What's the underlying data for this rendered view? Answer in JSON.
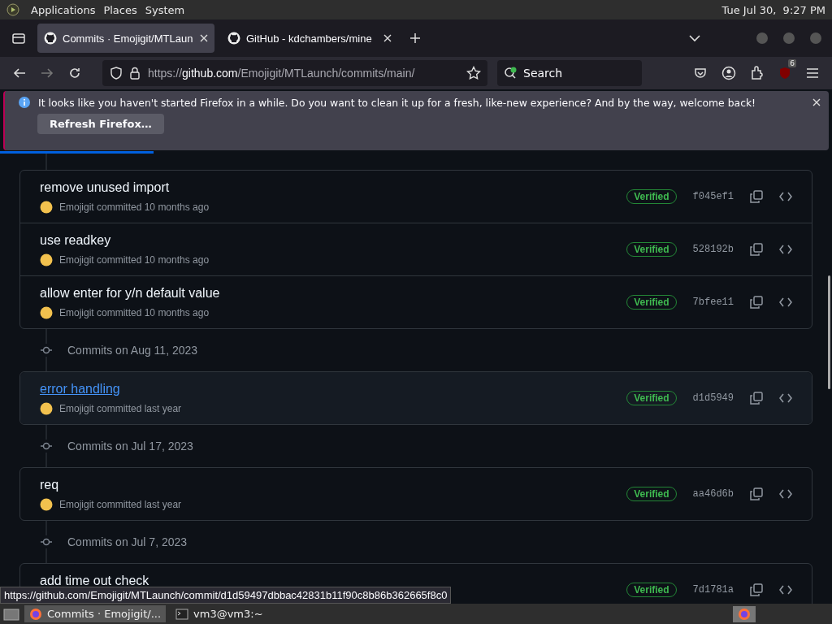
{
  "desktop_panel": {
    "menus": [
      "Applications",
      "Places",
      "System"
    ],
    "clock": "Tue Jul 30,  9:27 PM"
  },
  "tabs": [
    {
      "title": "Commits · Emojigit/MTLaun",
      "selected": true
    },
    {
      "title": "GitHub - kdchambers/mine",
      "selected": false
    }
  ],
  "address_bar": {
    "url_scheme": "https://",
    "url_domain": "github.com",
    "url_path": "/Emojigit/MTLaunch/commits/main/",
    "search_placeholder": "Search",
    "extension_badge": "6"
  },
  "notification": {
    "message": "It looks like you haven't started Firefox in a while. Do you want to clean it up for a fresh, like-new experience? And by the way, welcome back!",
    "button": "Refresh Firefox…"
  },
  "loading": {
    "level": 0.185
  },
  "commit_groups": [
    {
      "commits": [
        {
          "title": "remove unused import",
          "meta": "Emojigit committed 10 months ago",
          "badge": "Verified",
          "sha": "f045ef1",
          "hovered": false
        },
        {
          "title": "use readkey",
          "meta": "Emojigit committed 10 months ago",
          "badge": "Verified",
          "sha": "528192b",
          "hovered": false
        },
        {
          "title": "allow enter for y/n default value",
          "meta": "Emojigit committed 10 months ago",
          "badge": "Verified",
          "sha": "7bfee11",
          "hovered": false
        }
      ]
    },
    {
      "heading": "Commits on Aug 11, 2023",
      "commits": [
        {
          "title": "error handling",
          "meta": "Emojigit committed last year",
          "badge": "Verified",
          "sha": "d1d5949",
          "hovered": true
        }
      ]
    },
    {
      "heading": "Commits on Jul 17, 2023",
      "commits": [
        {
          "title": "req",
          "meta": "Emojigit committed last year",
          "badge": "Verified",
          "sha": "aa46d6b",
          "hovered": false
        }
      ]
    },
    {
      "heading": "Commits on Jul 7, 2023",
      "commits": [
        {
          "title": "add time out check",
          "badge": "Verified",
          "sha": "7d1781a",
          "hovered": false
        }
      ]
    }
  ],
  "status_url": "https://github.com/Emojigit/MTLaunch/commit/d1d59497dbbac42831b11f90c8b86b362665f8c0",
  "taskbar": [
    {
      "label": "Commits · Emojigit/...",
      "kind": "browser",
      "selected": true
    },
    {
      "label": "vm3@vm3:~",
      "kind": "terminal",
      "selected": false
    }
  ]
}
